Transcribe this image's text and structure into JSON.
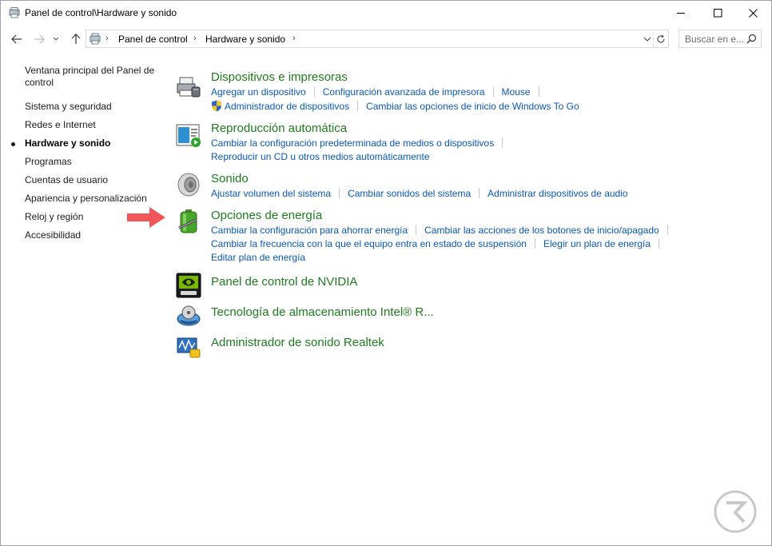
{
  "window": {
    "title": "Panel de control\\Hardware y sonido"
  },
  "navigation": {
    "breadcrumbs": [
      "Panel de control",
      "Hardware y sonido"
    ],
    "search_placeholder": "Buscar en e..."
  },
  "sidebar": {
    "items": [
      {
        "label": "Ventana principal del Panel de control",
        "active": false
      },
      {
        "label": "Sistema y seguridad",
        "active": false
      },
      {
        "label": "Redes e Internet",
        "active": false
      },
      {
        "label": "Hardware y sonido",
        "active": true
      },
      {
        "label": "Programas",
        "active": false
      },
      {
        "label": "Cuentas de usuario",
        "active": false
      },
      {
        "label": "Apariencia y personalización",
        "active": false
      },
      {
        "label": "Reloj y región",
        "active": false
      },
      {
        "label": "Accesibilidad",
        "active": false
      }
    ]
  },
  "categories": {
    "devices": {
      "title": "Dispositivos e impresoras",
      "icon": "printer-icon",
      "links_row1": [
        "Agregar un dispositivo",
        "Configuración avanzada de impresora",
        "Mouse"
      ],
      "links_row2": [
        "Administrador de dispositivos",
        "Cambiar las opciones de inicio de Windows To Go"
      ]
    },
    "autoplay": {
      "title": "Reproducción automática",
      "icon": "autoplay-icon",
      "links_row1": [
        "Cambiar la configuración predeterminada de medios o dispositivos"
      ],
      "links_row2": [
        "Reproducir un CD u otros medios automáticamente"
      ]
    },
    "sound": {
      "title": "Sonido",
      "icon": "speaker-icon",
      "links_row1": [
        "Ajustar volumen del sistema",
        "Cambiar sonidos del sistema",
        "Administrar dispositivos de audio"
      ]
    },
    "power": {
      "title": "Opciones de energía",
      "icon": "battery-icon",
      "links_row1": [
        "Cambiar la configuración para ahorrar energía",
        "Cambiar las acciones de los botones de inicio/apagado"
      ],
      "links_row2": [
        "Cambiar la frecuencia con la que el equipo entra en estado de suspensión",
        "Elegir un plan de energía"
      ],
      "links_row3": [
        "Editar plan de energía"
      ]
    },
    "nvidia": {
      "title": "Panel de control de NVIDIA",
      "icon": "nvidia-icon"
    },
    "intel": {
      "title": "Tecnología de almacenamiento Intel® R...",
      "icon": "intel-storage-icon"
    },
    "realtek": {
      "title": "Administrador de sonido Realtek",
      "icon": "realtek-icon"
    }
  },
  "colors": {
    "category_title": "#1e7b1e",
    "link": "#0a58b5",
    "pointer_arrow": "#f0565a"
  }
}
